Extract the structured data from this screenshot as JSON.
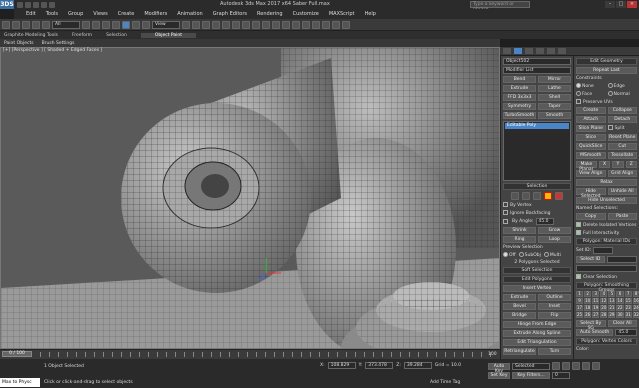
{
  "app": {
    "logo": "3DS",
    "window_title": "Autodesk 3ds Max 2017 x64   Saber Full.max",
    "search_placeholder": "Type a keyword or phrase"
  },
  "menu": [
    "Edit",
    "Tools",
    "Group",
    "Views",
    "Create",
    "Modifiers",
    "Animation",
    "Graph Editors",
    "Rendering",
    "Customize",
    "MAXScript",
    "Help"
  ],
  "toolbar": {
    "selection_filter": "All",
    "reference_coord": "View"
  },
  "ribbon": {
    "tabs": [
      "Graphite Modeling Tools",
      "Freeform",
      "Selection",
      "Object Paint"
    ],
    "active_tab": "Object Paint",
    "subtabs": [
      "Paint Objects",
      "Brush Settings"
    ]
  },
  "viewport": {
    "label": "[+] [Perspective ] [ Shaded + Edged Faces ]",
    "background": "#5a5a5a"
  },
  "modify_panel": {
    "object_name": "Object502",
    "modifier_list_label": "Modifier List",
    "buttons": [
      "Bend",
      "Mirror",
      "Extrude",
      "Lathe",
      "FFD 3x3x3",
      "Shell",
      "Symmetry",
      "Taper",
      "TurboSmooth",
      "Smooth"
    ],
    "stack_item": "Editable Poly",
    "selection_header": "Selection",
    "by_vertex": "By Vertex",
    "ignore_backfacing": "Ignore Backfacing",
    "by_angle": "By Angle:",
    "by_angle_value": "45.0",
    "shrink": "Shrink",
    "grow": "Grow",
    "ring": "Ring",
    "loop": "Loop",
    "preview_selection": "Preview Selection",
    "preview_options": [
      "Off",
      "SubObj",
      "Multi"
    ],
    "selected_status": "2 Polygons Selected",
    "soft_selection": "Soft Selection",
    "edit_polygons": "Edit Polygons",
    "insert_vertex": "Insert Vertex",
    "poly_buttons": [
      "Extrude",
      "Outline",
      "Bevel",
      "Inset",
      "Bridge",
      "Flip"
    ],
    "hinge": "Hinge From Edge",
    "extrude_spline": "Extrude Along Spline",
    "edit_triangulation": "Edit Triangulation",
    "retriangulate": "Retriangulate",
    "turn": "Turn"
  },
  "command_panel": {
    "edit_geometry": "Edit Geometry",
    "repeat_last": "Repeat Last",
    "constraints": "Constraints",
    "constraint_options": [
      "None",
      "Edge",
      "Face",
      "Normal"
    ],
    "preserve_uvs": "Preserve UVs",
    "create": "Create",
    "collapse": "Collapse",
    "attach": "Attach",
    "detach": "Detach",
    "slice_plane": "Slice Plane",
    "split": "Split",
    "slice": "Slice",
    "reset_plane": "Reset Plane",
    "quickslice": "QuickSlice",
    "cut": "Cut",
    "msmooth": "MSmooth",
    "tessellate": "Tessellate",
    "make_planar": "Make Planar",
    "xyz": [
      "X",
      "Y",
      "Z"
    ],
    "view_align": "View Align",
    "grid_align": "Grid Align",
    "relax": "Relax",
    "hide_selected": "Hide Selected",
    "unhide_all": "Unhide All",
    "hide_unselected": "Hide Unselected",
    "named_selections": "Named Selections:",
    "copy": "Copy",
    "paste": "Paste",
    "delete_isolated": "Delete Isolated Vertices",
    "full_interactivity": "Full Interactivity",
    "material_ids_header": "Polygon: Material IDs",
    "set_id": "Set ID:",
    "select_id": "Select ID",
    "clear_selection": "Clear Selection",
    "smoothing_header": "Polygon: Smoothing Groups",
    "smoothing_groups": [
      "1",
      "2",
      "3",
      "4",
      "5",
      "6",
      "7",
      "8",
      "9",
      "10",
      "11",
      "12",
      "13",
      "14",
      "15",
      "16",
      "17",
      "18",
      "19",
      "20",
      "21",
      "22",
      "23",
      "24",
      "25",
      "26",
      "27",
      "28",
      "29",
      "30",
      "31",
      "32"
    ],
    "select_by_sg": "Select By SG",
    "clear_all": "Clear All",
    "auto_smooth": "Auto Smooth",
    "auto_smooth_value": "45.0",
    "vertex_colors_header": "Polygon: Vertex Colors",
    "color": "Color:"
  },
  "timeline": {
    "slider": "0 / 100",
    "end": "100"
  },
  "status": {
    "maxscript": "Max to Physc",
    "selected": "1 Object Selected",
    "prompt": "Click or click-and-drag to select objects",
    "x": "108.829",
    "y": "373.478",
    "z": "39.284",
    "grid": "Grid = 10.0",
    "add_time_tag": "Add Time Tag",
    "auto_key": "Auto Key",
    "selected_label": "Selected",
    "set_key": "Set Key",
    "key_filters": "Key Filters...",
    "frame": "0"
  }
}
